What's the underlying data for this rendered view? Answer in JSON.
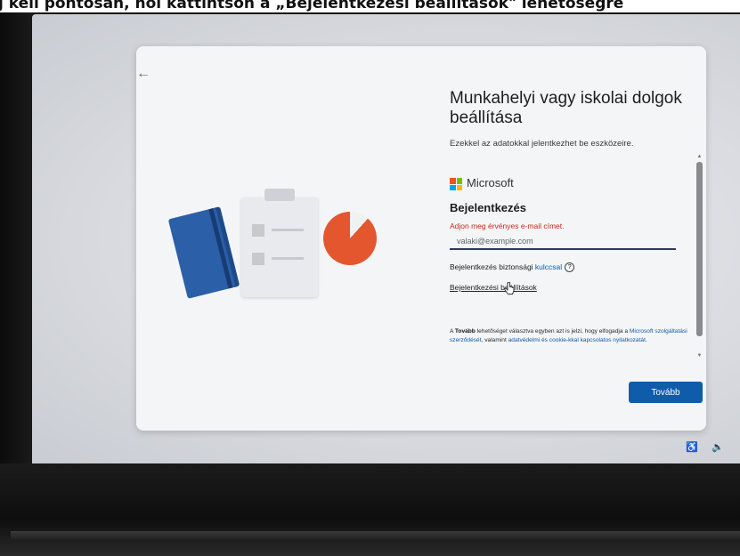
{
  "top_caption": "j   kell   pontosan, hol       kattintson      a  „Bejelentkezési beállítások\" lehetőségre",
  "setup": {
    "title": "Munkahelyi vagy iskolai dolgok beállítása",
    "subtitle": "Ezekkel az adatokkal jelentkezhet be eszközeire.",
    "brand": "Microsoft",
    "brand_colors": [
      "#f25022",
      "#7fba00",
      "#00a4ef",
      "#ffb900"
    ],
    "signin_heading": "Bejelentkezés",
    "error_text": "Adjon meg érvényes e-mail címet.",
    "email_placeholder": "valaki@example.com",
    "security_key_prefix": "Bejelentkezés biztonsági ",
    "security_key_word": "kulccsal",
    "help_icon_glyph": "?",
    "signin_options": "Bejelentkezési beállítások",
    "legal_prefix": "A ",
    "legal_bold": "Tovább",
    "legal_mid": " lehetőséget választva egyben azt is jelzi, hogy elfogadja a ",
    "legal_link1": "Microsoft szolgáltatási szerződését",
    "legal_mid2": ", valamint ",
    "legal_link2": "adatvédelmi és cookie-kkal kapcsolatos nyilatkozatát",
    "legal_end": ".",
    "next_button": "Tovább",
    "back_glyph": "←",
    "accent_color": "#0f5cab",
    "error_color": "#c42b1c"
  },
  "tray": {
    "accessibility_icon": "accessibility-icon",
    "accessibility_glyph": "♿",
    "volume_icon": "volume-icon",
    "volume_glyph": "🔈"
  }
}
